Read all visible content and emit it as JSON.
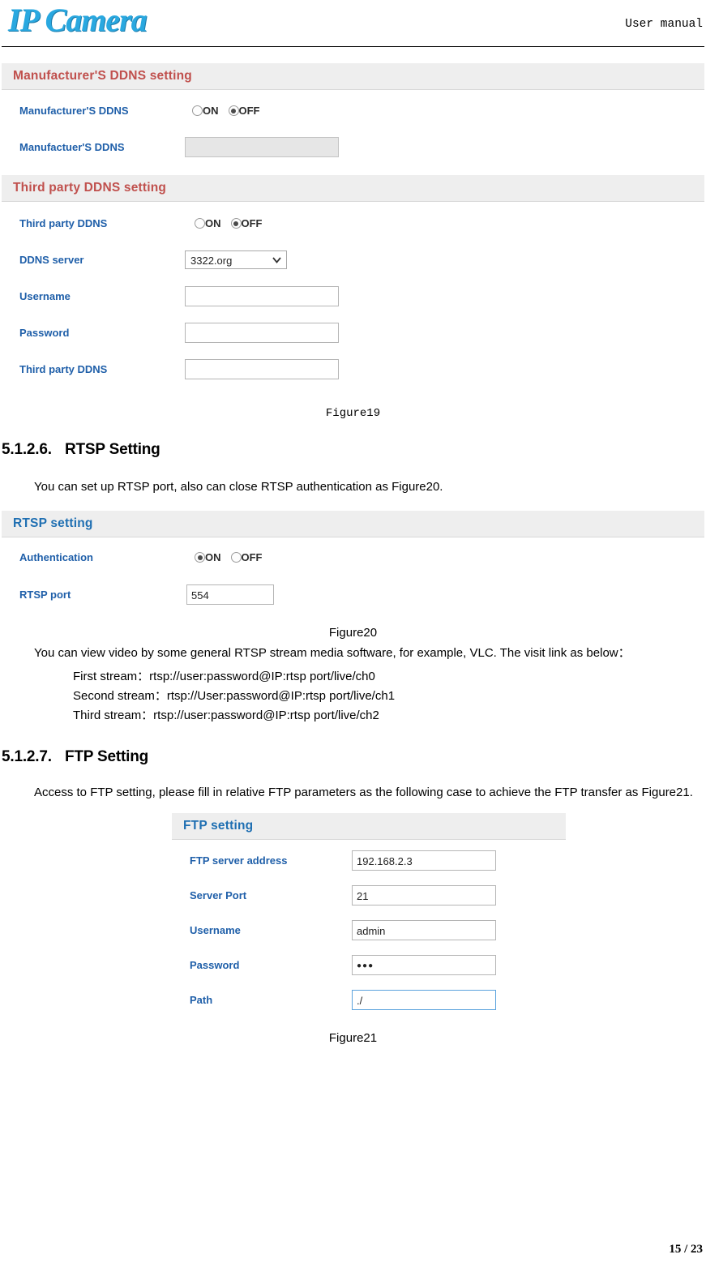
{
  "header": {
    "logo_text": "IP Camera",
    "right_text": "User manual"
  },
  "ddns_panel": {
    "manufacturer_section": {
      "title": "Manufacturer'S DDNS setting",
      "rows": [
        {
          "label": "Manufacturer'S DDNS",
          "type": "radio",
          "on_label": "ON",
          "off_label": "OFF",
          "selected": "OFF"
        },
        {
          "label": "Manufactuer'S DDNS",
          "type": "text",
          "value": "",
          "disabled": true
        }
      ]
    },
    "third_party_section": {
      "title": "Third party DDNS setting",
      "rows": [
        {
          "label": "Third party DDNS",
          "type": "radio",
          "on_label": "ON",
          "off_label": "OFF",
          "selected": "OFF"
        },
        {
          "label": "DDNS server",
          "type": "select",
          "value": "3322.org"
        },
        {
          "label": "Username",
          "type": "text",
          "value": ""
        },
        {
          "label": "Password",
          "type": "text",
          "value": ""
        },
        {
          "label": "Third party DDNS",
          "type": "text",
          "value": ""
        }
      ]
    },
    "caption": "Figure19"
  },
  "rtsp": {
    "heading_num": "5.1.2.6.",
    "heading_text": "RTSP Setting",
    "intro": "You can set up RTSP port, also can close RTSP authentication as Figure20.",
    "panel": {
      "title": "RTSP setting",
      "rows": [
        {
          "label": "Authentication",
          "type": "radio",
          "on_label": "ON",
          "off_label": "OFF",
          "selected": "ON"
        },
        {
          "label": "RTSP port",
          "type": "text",
          "value": "554"
        }
      ]
    },
    "caption": "Figure20",
    "paragraph": "You can view video by some general RTSP stream media software, for example, VLC. The visit link as below：",
    "streams": [
      "First stream：rtsp://user:password@IP:rtsp port/live/ch0",
      "Second stream：rtsp://User:password@IP:rtsp port/live/ch1",
      "Third stream：rtsp://user:password@IP:rtsp port/live/ch2"
    ]
  },
  "ftp": {
    "heading_num": "5.1.2.7.",
    "heading_text": "FTP Setting",
    "paragraph": "Access to FTP setting, please fill in relative FTP parameters as the following case to achieve the FTP transfer as Figure21.",
    "panel": {
      "title": "FTP setting",
      "rows": [
        {
          "label": "FTP server address",
          "value": "192.168.2.3"
        },
        {
          "label": "Server Port",
          "value": "21"
        },
        {
          "label": "Username",
          "value": "admin"
        },
        {
          "label": "Password",
          "value": "●●●"
        },
        {
          "label": "Path",
          "value": "./",
          "focused": true
        }
      ]
    },
    "caption": "Figure21"
  },
  "footer": {
    "page": "15 / 23"
  }
}
